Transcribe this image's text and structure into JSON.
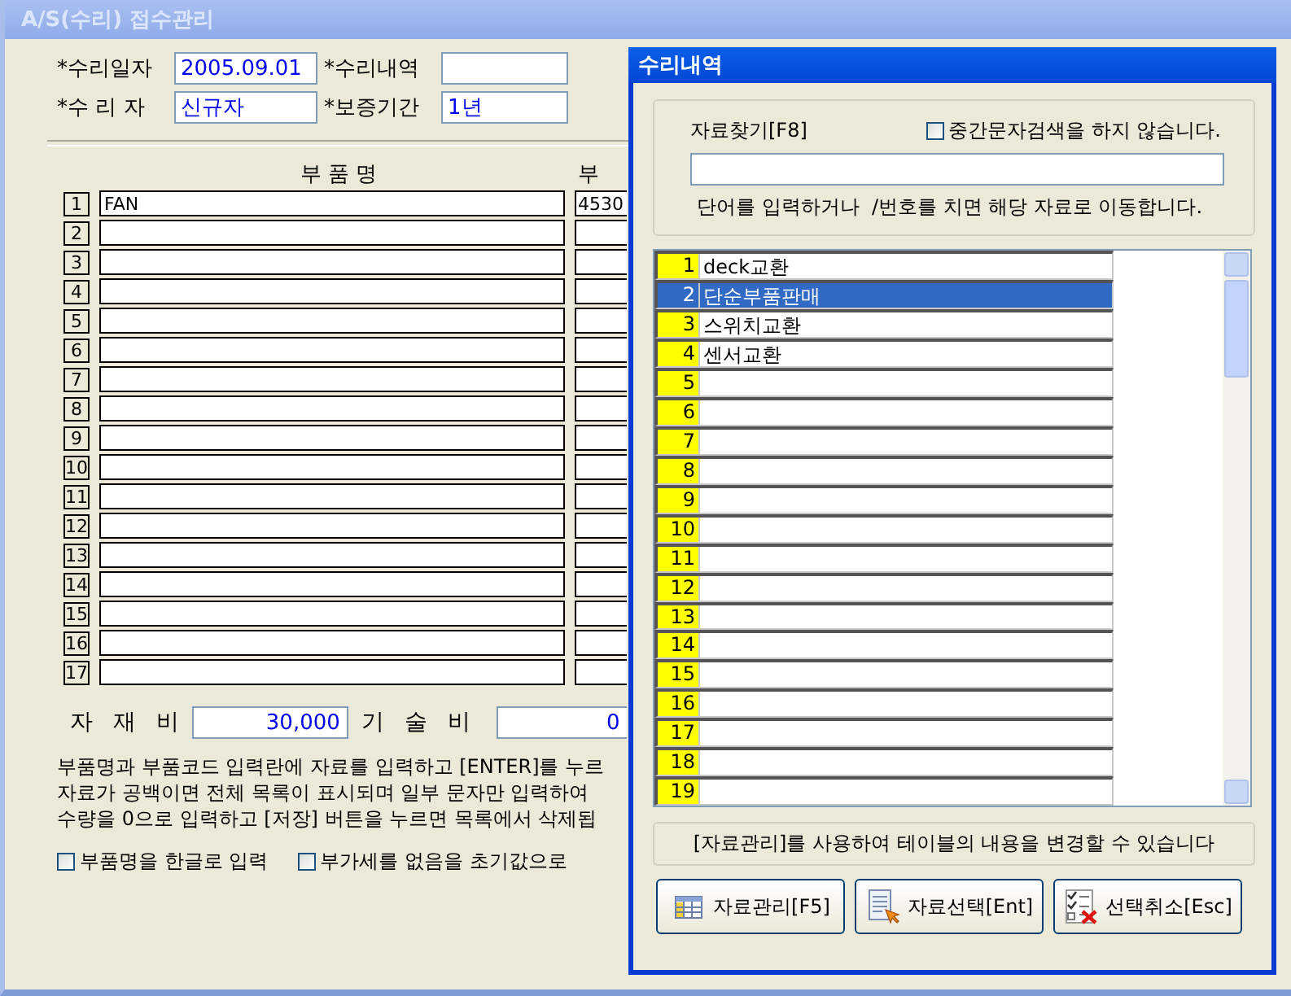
{
  "window": {
    "title": "A/S(수리) 접수관리"
  },
  "fields": [
    {
      "label": "*수리일자",
      "value": "2005.09.01"
    },
    {
      "label": "*수리내역"
    },
    {
      "label": "*수 리 자",
      "value": "신규자"
    },
    {
      "label": "*보증기간",
      "value": "1년"
    }
  ],
  "parts": {
    "columns": [
      "부 품 명",
      "부"
    ],
    "rows": [
      {
        "number": "1",
        "name": "FAN",
        "code": "4530"
      },
      {
        "number": "2"
      },
      {
        "number": "3"
      },
      {
        "number": "4"
      },
      {
        "number": "5"
      },
      {
        "number": "6"
      },
      {
        "number": "7"
      },
      {
        "number": "8"
      },
      {
        "number": "9"
      },
      {
        "number": "10"
      },
      {
        "number": "11"
      },
      {
        "number": "12"
      },
      {
        "number": "13"
      },
      {
        "number": "14"
      },
      {
        "number": "15"
      },
      {
        "number": "16"
      },
      {
        "number": "17"
      }
    ]
  },
  "costs": [
    {
      "label": "자 재 비",
      "value": "30,000"
    },
    {
      "label": "기 술 비",
      "value": "0"
    }
  ],
  "notes": [
    "부품명과 부품코드 입력란에 자료를 입력하고 [ENTER]를 누르",
    "자료가 공백이면 전체 목록이 표시되며 일부 문자만 입력하여",
    "수량을 0으로 입력하고 [저장] 버튼을 누르면 목록에서 삭제됩"
  ],
  "options": [
    {
      "label": "부품명을 한글로 입력",
      "checked": false
    },
    {
      "label": "부가세를 없음을 초기값으로",
      "checked": false
    }
  ],
  "dialog": {
    "title": "수리내역",
    "search": {
      "label": "자료찾기[F8]",
      "option": {
        "label": "중간문자검색을 하지 않습니다.",
        "checked": false
      },
      "hint": "단어를 입력하거나  /번호를 치면 해당 자료로 이동합니다."
    },
    "list": [
      {
        "number": "1",
        "name": "deck교환",
        "selected": false
      },
      {
        "number": "2",
        "name": "단순부품판매",
        "selected": true
      },
      {
        "number": "3",
        "name": "스위치교환",
        "selected": false
      },
      {
        "number": "4",
        "name": "센서교환",
        "selected": false
      },
      {
        "number": "5",
        "selected": false
      },
      {
        "number": "6",
        "selected": false
      },
      {
        "number": "7",
        "selected": false
      },
      {
        "number": "8",
        "selected": false
      },
      {
        "number": "9",
        "selected": false
      },
      {
        "number": "10",
        "selected": false
      },
      {
        "number": "11",
        "selected": false
      },
      {
        "number": "12",
        "selected": false
      },
      {
        "number": "13",
        "selected": false
      },
      {
        "number": "14",
        "selected": false
      },
      {
        "number": "15",
        "selected": false
      },
      {
        "number": "16",
        "selected": false
      },
      {
        "number": "17",
        "selected": false
      },
      {
        "number": "18",
        "selected": false
      },
      {
        "number": "19",
        "selected": false
      }
    ],
    "info": "[자료관리]를 사용하여 테이블의 내용을 변경할 수 있습니다",
    "buttons": [
      {
        "label": "자료관리[F5]",
        "kind": "grid"
      },
      {
        "label": "자료선택[Ent]",
        "kind": "document"
      },
      {
        "label": "선택취소[Esc]",
        "kind": "cancel"
      }
    ]
  }
}
